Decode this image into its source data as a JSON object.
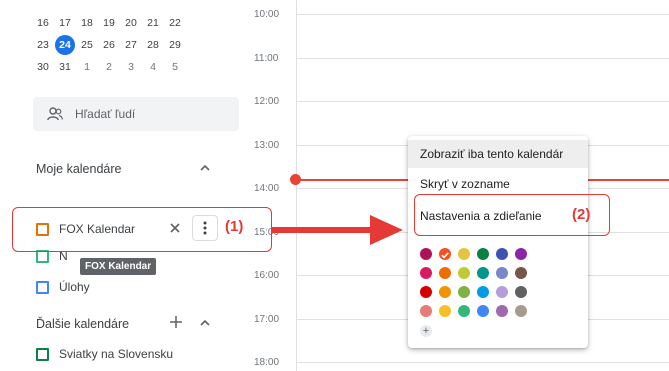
{
  "mini_calendar": {
    "rows": [
      [
        {
          "d": "16",
          "muted": false
        },
        {
          "d": "17",
          "muted": false
        },
        {
          "d": "18",
          "muted": false
        },
        {
          "d": "19",
          "muted": false
        },
        {
          "d": "20",
          "muted": false
        },
        {
          "d": "21",
          "muted": false
        },
        {
          "d": "22",
          "muted": false
        }
      ],
      [
        {
          "d": "23",
          "muted": false
        },
        {
          "d": "24",
          "muted": false,
          "today": true
        },
        {
          "d": "25",
          "muted": false
        },
        {
          "d": "26",
          "muted": false
        },
        {
          "d": "27",
          "muted": false
        },
        {
          "d": "28",
          "muted": false
        },
        {
          "d": "29",
          "muted": false
        }
      ],
      [
        {
          "d": "30",
          "muted": false
        },
        {
          "d": "31",
          "muted": false
        },
        {
          "d": "1",
          "muted": true
        },
        {
          "d": "2",
          "muted": true
        },
        {
          "d": "3",
          "muted": true
        },
        {
          "d": "4",
          "muted": true
        },
        {
          "d": "5",
          "muted": true
        }
      ]
    ]
  },
  "search_people": {
    "label": "Hľadať ľudí"
  },
  "my_calendars": {
    "title": "Moje kalendáre",
    "items": [
      {
        "label": "FOX Kalendar",
        "color": "#e8710a"
      },
      {
        "label": "N",
        "color": "#33b679"
      },
      {
        "label": "Úlohy",
        "color": "#4285f4"
      }
    ]
  },
  "tooltip": {
    "text": "FOX Kalendar"
  },
  "other_calendars": {
    "title": "Ďalšie kalendáre",
    "items": [
      {
        "label": "Sviatky na Slovensku",
        "color": "#0b8043"
      }
    ]
  },
  "times": [
    "10:00",
    "11:00",
    "12:00",
    "13:00",
    "14:00",
    "15:00",
    "16:00",
    "17:00",
    "18:00"
  ],
  "menu": {
    "items": [
      "Zobraziť iba tento kalendár",
      "Skryť v zozname",
      "Nastavenia a zdieľanie"
    ],
    "colors": [
      [
        "#ad1457",
        "#f4511e",
        "#e4c441",
        "#0b8043",
        "#3f51b5",
        "#8e24aa"
      ],
      [
        "#d81b60",
        "#ef6c00",
        "#c0ca33",
        "#009688",
        "#7986cb",
        "#795548"
      ],
      [
        "#d50000",
        "#f09300",
        "#7cb342",
        "#039be5",
        "#b39ddb",
        "#616161"
      ],
      [
        "#e67c73",
        "#f6bf26",
        "#33b679",
        "#4285f4",
        "#9e69af",
        "#a79b8e"
      ]
    ],
    "selected_color": "#f4511e",
    "add_symbol": "+"
  },
  "callouts": {
    "one": "(1)",
    "two": "(2)"
  },
  "accent": {
    "red": "#e53935",
    "now_line": "#ea4335",
    "today": "#1a73e8"
  }
}
